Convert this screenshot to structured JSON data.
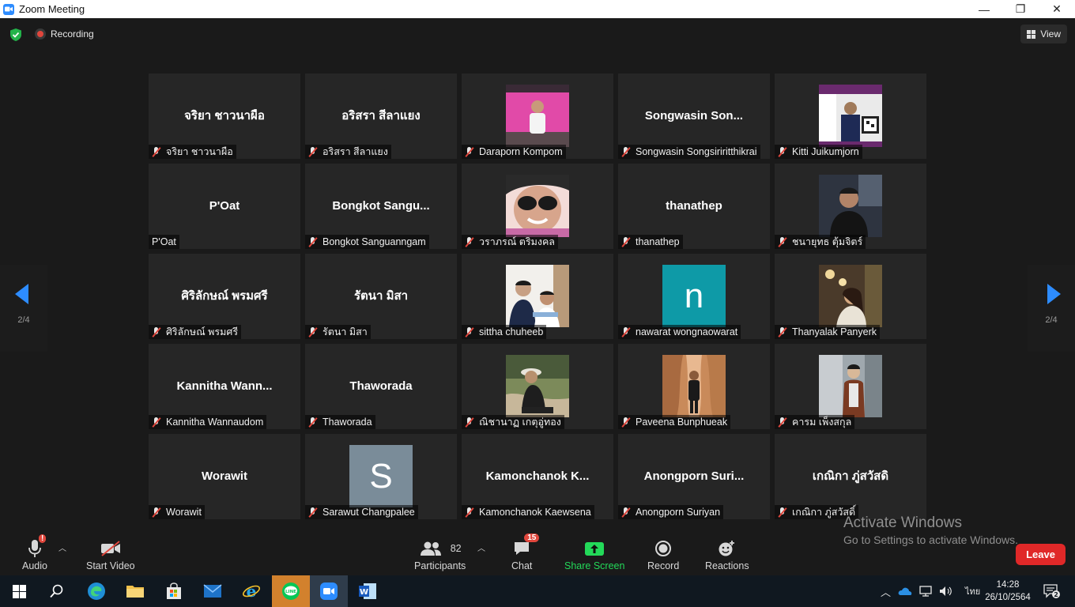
{
  "window": {
    "title": "Zoom Meeting",
    "minimize": "—",
    "maximize": "❐",
    "close": "✕"
  },
  "topbar": {
    "recording_label": "Recording",
    "view_label": "View"
  },
  "pager": {
    "left_page": "2/4",
    "right_page": "2/4"
  },
  "tiles": [
    {
      "display": "จริยา ชาวนาผือ",
      "name": "จริยา ชาวนาผือ",
      "muted": true
    },
    {
      "display": "อริสรา สีลาแยง",
      "name": "อริสรา สีลาแยง",
      "muted": true
    },
    {
      "display": "",
      "name": "Daraporn Kompom",
      "muted": true,
      "photo": "photo-pink"
    },
    {
      "display": "Songwasin  Son...",
      "name": "Songwasin Songsiriritthikrai",
      "muted": true
    },
    {
      "display": "",
      "name": "Kitti Juikumjorn",
      "muted": true,
      "photo": "photo-poster"
    },
    {
      "display": "P'Oat",
      "name": "P'Oat",
      "muted": false
    },
    {
      "display": "Bongkot  Sangu...",
      "name": "Bongkot Sanguanngam",
      "muted": true
    },
    {
      "display": "",
      "name": "วราภรณ์ ตริมงคล",
      "muted": true,
      "photo": "photo-sunglasses"
    },
    {
      "display": "thanathep",
      "name": "thanathep",
      "muted": true
    },
    {
      "display": "",
      "name": "ชนายุทธ ตุ้มจิตร์",
      "muted": true,
      "photo": "photo-man-dark"
    },
    {
      "display": "ศิริลักษณ์ พรมศรี",
      "name": "ศิริลักษณ์ พรมศรี",
      "muted": true
    },
    {
      "display": "รัตนา มิสา",
      "name": "รัตนา มิสา",
      "muted": true
    },
    {
      "display": "",
      "name": "sittha chuheeb",
      "muted": true,
      "photo": "photo-two-people"
    },
    {
      "display": "",
      "name": "nawarat wongnaowarat",
      "muted": true,
      "letter": "n",
      "letter_bg": "#0e9aa7"
    },
    {
      "display": "",
      "name": "Thanyalak Panyerk",
      "muted": true,
      "photo": "photo-cafe"
    },
    {
      "display": "Kannitha  Wann...",
      "name": "Kannitha Wannaudom",
      "muted": true
    },
    {
      "display": "Thaworada",
      "name": "Thaworada",
      "muted": true
    },
    {
      "display": "",
      "name": "ณิชานาฏ เกตุอู่ทอง",
      "muted": true,
      "photo": "photo-outdoor"
    },
    {
      "display": "",
      "name": "Paveena Bunphueak",
      "muted": true,
      "photo": "photo-canyon"
    },
    {
      "display": "",
      "name": "คารม เพ็งสกุล",
      "muted": true,
      "photo": "photo-man-brown"
    },
    {
      "display": "Worawit",
      "name": "Worawit",
      "muted": true
    },
    {
      "display": "",
      "name": "Sarawut Changpalee",
      "muted": true,
      "letter": "S",
      "letter_bg": "#7a8c99"
    },
    {
      "display": "Kamonchanok  K...",
      "name": "Kamonchanok Kaewsena",
      "muted": true
    },
    {
      "display": "Anongporn  Suri...",
      "name": "Anongporn Suriyan",
      "muted": true
    },
    {
      "display": "เกณิกา ภู่สวัสดิ",
      "name": "เกณิกา ภู่สวัสดิ์",
      "muted": true
    }
  ],
  "toolbar": {
    "audio_label": "Audio",
    "audio_alert": "!",
    "video_label": "Start Video",
    "participants_label": "Participants",
    "participants_count": "82",
    "chat_label": "Chat",
    "chat_badge": "15",
    "share_label": "Share Screen",
    "record_label": "Record",
    "reactions_label": "Reactions",
    "leave_label": "Leave"
  },
  "watermark": {
    "line1": "Activate Windows",
    "line2": "Go to Settings to activate Windows."
  },
  "taskbar": {
    "ime": "ไทย",
    "time": "14:28",
    "date": "26/10/2564",
    "notification_count": "2",
    "line_label": "LINE"
  },
  "colors": {
    "accent": "#2d8cff",
    "leave": "#e02828",
    "share": "#23d959",
    "mute": "#e0463c"
  }
}
